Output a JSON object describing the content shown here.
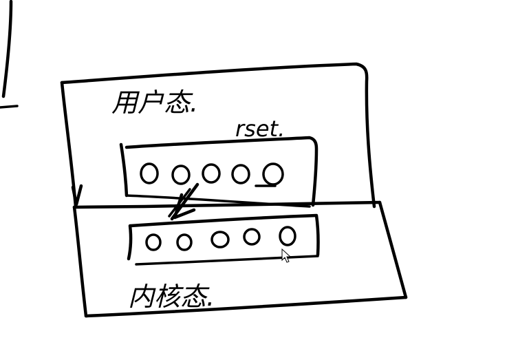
{
  "canvas": {
    "background": "#ffffff",
    "ink_color": "#000000"
  },
  "labels": {
    "user_mode": "用户态.",
    "kernel_mode": "内核态.",
    "fd_set": "rset."
  },
  "user_bitmap": {
    "cells": [
      "0",
      "0",
      "0",
      "0",
      "0"
    ],
    "marked_cell": 5
  },
  "kernel_bitmap": {
    "cells": [
      "0",
      "0",
      "0",
      "0",
      "0"
    ]
  },
  "icons": {
    "copy_arrow": "arrow-down-left-icon",
    "pointer": "mouse-cursor-icon"
  }
}
